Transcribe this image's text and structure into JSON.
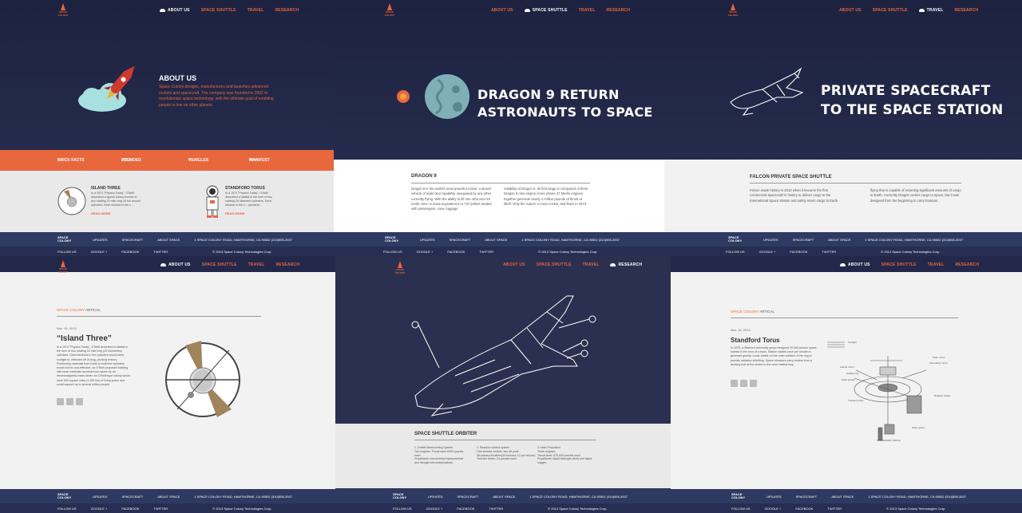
{
  "nav": {
    "about": "ABOUT US",
    "shuttle": "SPACE SHUTTLE",
    "travel": "TRAVEL",
    "research": "RESEARCH"
  },
  "logo": {
    "line1": "SPACE",
    "line2": "COLONY"
  },
  "about": {
    "heading": "ABOUT US",
    "text": "Space Colony designs, manufactures and launches advanced rockets and spacecraft. The company was founded in 2002 to revolutionize space technology, with the ultimate goal of enabling people to live on other planets."
  },
  "facts": {
    "label": "BRICK FACTS",
    "founded_label": "FOUNDED",
    "founded_value": "2003",
    "vehicles_label": "VEHICLES",
    "vehicles_value": "4",
    "manifest_label": "MANIFEST",
    "manifest_value": "40+"
  },
  "vehicles": [
    {
      "title": "ISLAND THREE",
      "text": "In a 1974 \"Physics Today\", O'Neill described a typical colony formed of two rotating 20 mile long 20 km around cylinders. Each window in the c...",
      "more": "READ MORE"
    },
    {
      "title": "STANDFORD TORUS",
      "text": "In a 1974 \"Physics Today\", O'Neill described a habitat in the form of two rotating 20 kilometre cylinders. Each window in the c... cylinders...",
      "more": "READ MORE"
    }
  ],
  "dragon_hero": {
    "line1": "DRAGON 9 RETURN",
    "line2": "ASTRONAUTS TO SPACE"
  },
  "dragon": {
    "heading": "DRAGON 9",
    "col1": "Dragon 9 is the world's most powerful rocket, a launch vehicle of scale and capability unequaled by any other currently flying. With the ability to lift into orbit over 53 metric tons--a mass equivalent to a 737 jetliner loaded with passengers, crew, luggage",
    "col2": "reliability of Dragon 9. Its first stage is composed of three Dragon 9 nine engine cores whose 27 Merlin engines together generate nearly 4 million pounds of thrust at liftoff. Only the Saturn V moon rocket, last flown in 1973."
  },
  "private_hero": {
    "line1": "PRIVATE SPACECRAFT",
    "line2": "TO THE SPACE STATION"
  },
  "falcon": {
    "heading": "FALCON PRIVATE SPACE SHUTTLE",
    "col1": "Falcon made history in 2012 when it became the first commercial spacecraft in history to deliver cargo to the International Space Station and safely return cargo to Earth.",
    "col2": "flying that is capable of returning significant amounts of cargo to Earth. Currently Dragon carries cargo to space, but it was designed from the beginning to carry humans."
  },
  "footer": {
    "brand1": "SPACE",
    "brand2": "COLONY",
    "updates": "UPDATES",
    "spacecraft": "SPACECRAFT",
    "about": "ABOUT SPACE",
    "address": "1 SPACE COLONY ROAD, HAWTHORNE, CA 90502 (310)555-3937",
    "follow": "FOLLOW US",
    "google": "GOOGLE +",
    "facebook": "FACEBOOK",
    "twitter": "TWITTER",
    "copy": "© 2013 Space Colony Technologies Corp."
  },
  "island": {
    "crumb_brand": "SPACE COLONY",
    "crumb_rest": "ARTICAL",
    "date": "Nov. 15, 2013",
    "title": "“Island Three”",
    "text": "In a 1974 \"Physics Today\", O'Neill described a habitat in the form of two rotating 20 mile long (32 kilometres) cylinders. Giant windows in the cylinders would allow sunlight in, reflected off of long, pivoting mirrors. Positioning materials from Earth to build the cylinders would not be cost-effective, so O'Neill proposed building with lunar materials launched into space by an electromagnetic mass driver. An O'Neill type colony would have 500 square miles (1,300 km) of living space and could support up to several million people."
  },
  "shuttle": {
    "heading": "SPACE SHUTTLE ORBITER",
    "col1": "1. Orbital Maneuvering System\nTwo engines: Thrust each 6000 pounds each\nPropellants: monomethyl hydrazine/fuel and nitrogen tetroxide(oxidizer)",
    "col2": "2. Reaction control system\nOne forward module, two aft pods\n38 primary thrusters(44 forward, 12 per aft pod)\nThruster levels: 24 pounds each",
    "col3": "3. Main Propulsion\nThree engines\nThrust level: 375,000 pounds each\nPropellants: liquid hydrogen (fuel) and liquid oxygen"
  },
  "torus": {
    "crumb_brand": "SPACE COLONY",
    "crumb_rest": "ARTICAL",
    "date": "Nov. 15, 2013",
    "title": "Standford Torus",
    "text": "In 1975, a Stanford University group designed 10,000 person space habitat in the form of a torus. Station rotates once per minute to generate gravity. Lunar rubble on the outer surface of the ring to provide radiation shielding. Space elevators carry visitors from a docking hub at the center to the outer habitat ring.",
    "labels": [
      "Sunlight",
      "Solar mirror",
      "Secondary mirror",
      "Lateral mirror",
      "Habitat ring",
      "Solar panels",
      "Transport tube",
      "Radiator shield",
      "Solar power",
      "STANDFORD TORUS"
    ]
  }
}
